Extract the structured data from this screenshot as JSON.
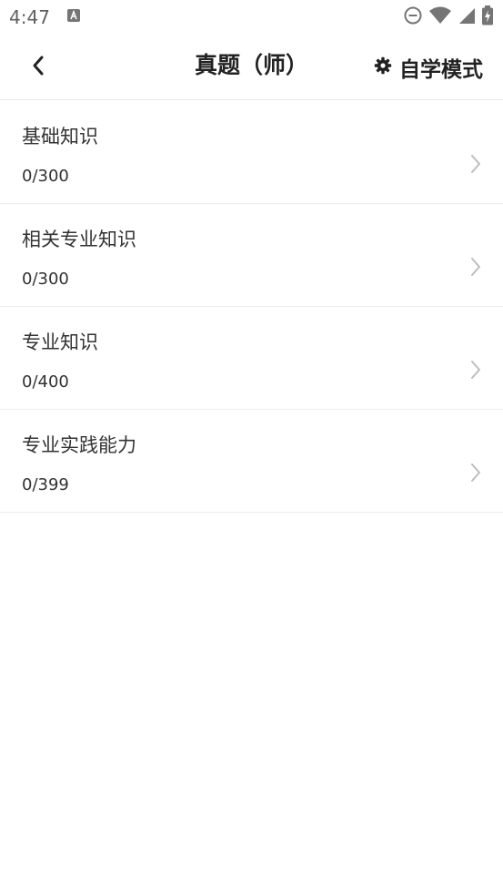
{
  "status": {
    "time": "4:47"
  },
  "header": {
    "back_icon": "chevron-left-icon",
    "title": "真题（师）",
    "mode_icon": "gear-icon",
    "mode_label": "自学模式"
  },
  "items": [
    {
      "name": "基础知识",
      "count": "0/300"
    },
    {
      "name": "相关专业知识",
      "count": "0/300"
    },
    {
      "name": "专业知识",
      "count": "0/400"
    },
    {
      "name": "专业实践能力",
      "count": "0/399"
    }
  ],
  "colors": {
    "text": "#222222",
    "muted": "#666666",
    "divider": "#ececec",
    "chevron": "#bdbdbd"
  }
}
